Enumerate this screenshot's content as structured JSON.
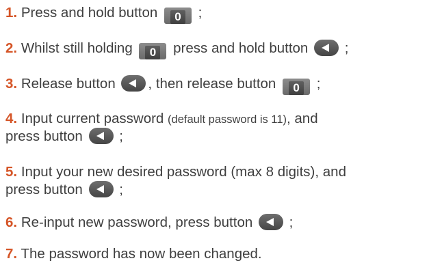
{
  "steps": [
    {
      "num": "1.",
      "t1": "Press and hold button",
      "t2": ";"
    },
    {
      "num": "2.",
      "t1": "Whilst still holding",
      "t2": "press and hold button",
      "t3": ";"
    },
    {
      "num": "3.",
      "t1": "Release button",
      "t2": ", then release button",
      "t3": ";"
    },
    {
      "num": "4.",
      "t1": "Input current password",
      "note": "(default password is 11)",
      "t2": ", and",
      "l2": "press button",
      "t3": ";"
    },
    {
      "num": "5.",
      "t1": "Input your new desired password (max 8 digits), and",
      "l2": "press button",
      "t3": ";"
    },
    {
      "num": "6.",
      "t1": "Re-input new password, press button",
      "t2": ";"
    },
    {
      "num": "7.",
      "t1": "The password has now been changed."
    }
  ],
  "keys": {
    "zero_label": "0",
    "zero_icon": "zero-key-icon",
    "back_icon": "back-arrow-key-icon"
  },
  "colors": {
    "step_number": "#d55527",
    "text": "#3f3f3f",
    "key": "#5a5a5a"
  }
}
